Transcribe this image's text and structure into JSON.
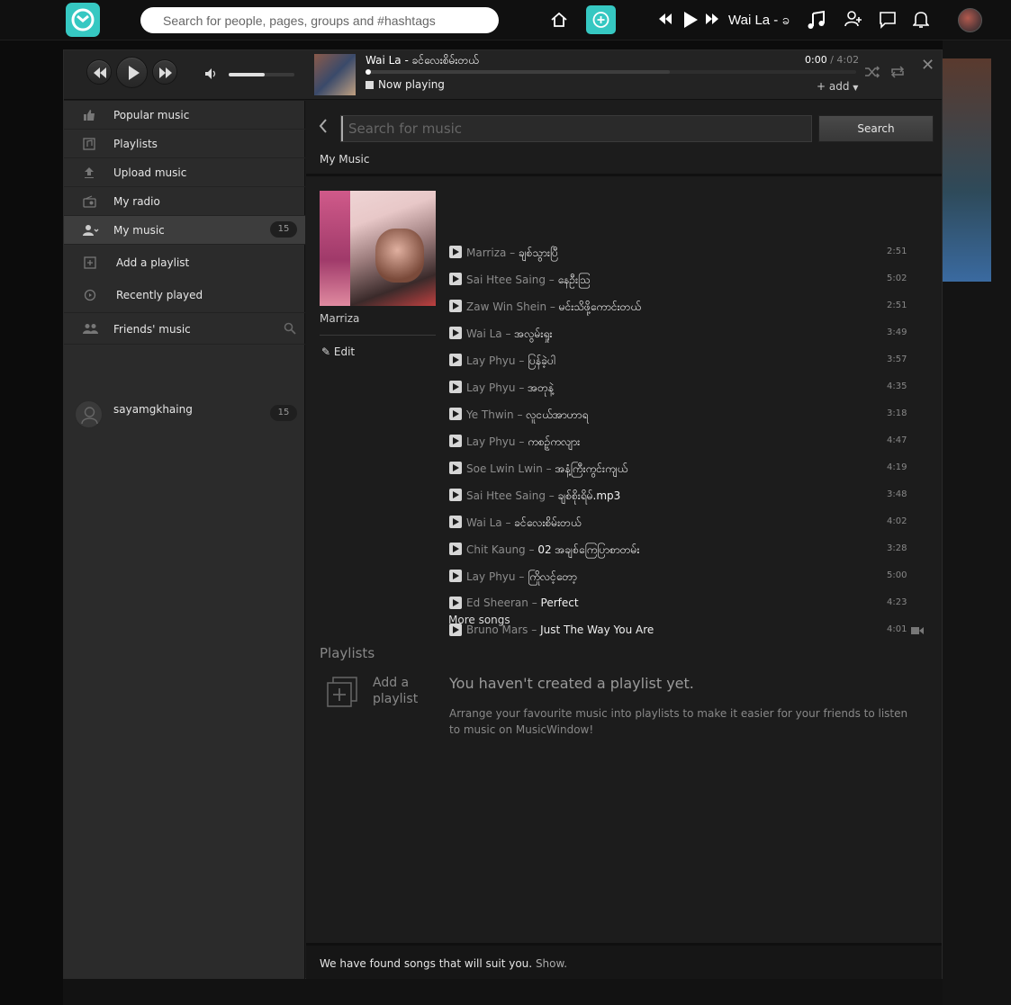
{
  "topbar": {
    "search_placeholder": "Search for people, pages, groups and #hashtags",
    "now_playing_short": "Wai La - ခ",
    "brand_color": "#36c8c2",
    "icons": [
      "home-icon",
      "add-icon",
      "rewind-icon",
      "play-icon",
      "fast-forward-icon",
      "music-note-icon",
      "add-friend-icon",
      "chat-icon",
      "bell-icon"
    ]
  },
  "player": {
    "track_title": "Wai La - ခင်လေးစိမ်းတယ်",
    "elapsed": "0:00",
    "duration": "/ 4:02",
    "status": "Now playing",
    "add_label": "+ add",
    "volume": 0.55,
    "progress": 0.0,
    "buffered": 0.62
  },
  "sidebar": {
    "items": [
      {
        "label": "Popular music",
        "icon": "thumbs-up-icon"
      },
      {
        "label": "Playlists",
        "icon": "playlist-icon"
      },
      {
        "label": "Upload music",
        "icon": "upload-icon"
      },
      {
        "label": "My radio",
        "icon": "radio-icon"
      },
      {
        "label": "My music",
        "icon": "user-music-icon",
        "count": "15"
      },
      {
        "label": "Add a playlist",
        "icon": "add-playlist-icon"
      },
      {
        "label": "Recently played",
        "icon": "recent-icon"
      },
      {
        "label": "Friends' music",
        "icon": "friends-icon"
      }
    ],
    "friend": {
      "name": "sayamgkhaing",
      "count": "15"
    }
  },
  "main": {
    "search_placeholder": "Search for music",
    "search_button": "Search",
    "section_title": "My Music",
    "album_name": "Marriza",
    "edit_label": "Edit",
    "tracks": [
      {
        "artist": "Marriza",
        "title": "ချစ်သွားပြီ",
        "duration": "2:51"
      },
      {
        "artist": "Sai Htee Saing",
        "title": "နေဦးသြ",
        "duration": "5:02"
      },
      {
        "artist": "Zaw Win Shein",
        "title": "မင်းသိဖို့ကောင်းတယ်",
        "duration": "2:51"
      },
      {
        "artist": "Wai La",
        "title": "အလွမ်းရှုး",
        "duration": "3:49"
      },
      {
        "artist": "Lay Phyu",
        "title": "ပြန်ခဲ့ပါ",
        "duration": "3:57"
      },
      {
        "artist": "Lay Phyu",
        "title": "အတုနဲ့",
        "duration": "4:35"
      },
      {
        "artist": "Ye Thwin",
        "title": "လူငယ်အာဟာရ",
        "duration": "3:18"
      },
      {
        "artist": "Lay Phyu",
        "title": "ကစဉ့်ကလျား",
        "duration": "4:47"
      },
      {
        "artist": "Soe Lwin Lwin",
        "title": "အနံ့ကြီးကွင်းကျယ်",
        "duration": "4:19"
      },
      {
        "artist": "Sai Htee Saing",
        "title": "ချစ်စိုးရိမ်.mp3",
        "duration": "3:48"
      },
      {
        "artist": "Wai La",
        "title": "ခင်လေးစိမ်းတယ်",
        "duration": "4:02"
      },
      {
        "artist": "Chit Kaung",
        "title": "02 အချစ်ကြေပြာစာတမ်း",
        "duration": "3:28"
      },
      {
        "artist": "Lay Phyu",
        "title": "ကြိုလင့်တော့",
        "duration": "5:00"
      },
      {
        "artist": "Ed Sheeran",
        "title": "Perfect",
        "duration": "4:23"
      },
      {
        "artist": "Bruno Mars",
        "title": "Just The Way You Are",
        "duration": "4:01",
        "video": true
      }
    ],
    "more_songs": "More songs",
    "playlists_heading": "Playlists",
    "add_playlist_label": "Add a playlist",
    "empty_title": "You haven't created a playlist yet.",
    "empty_desc": "Arrange your favourite music into playlists to make it easier for your friends to listen to music on MusicWindow!",
    "suggest_text": "We have found songs that will suit you.",
    "suggest_link": "Show."
  }
}
